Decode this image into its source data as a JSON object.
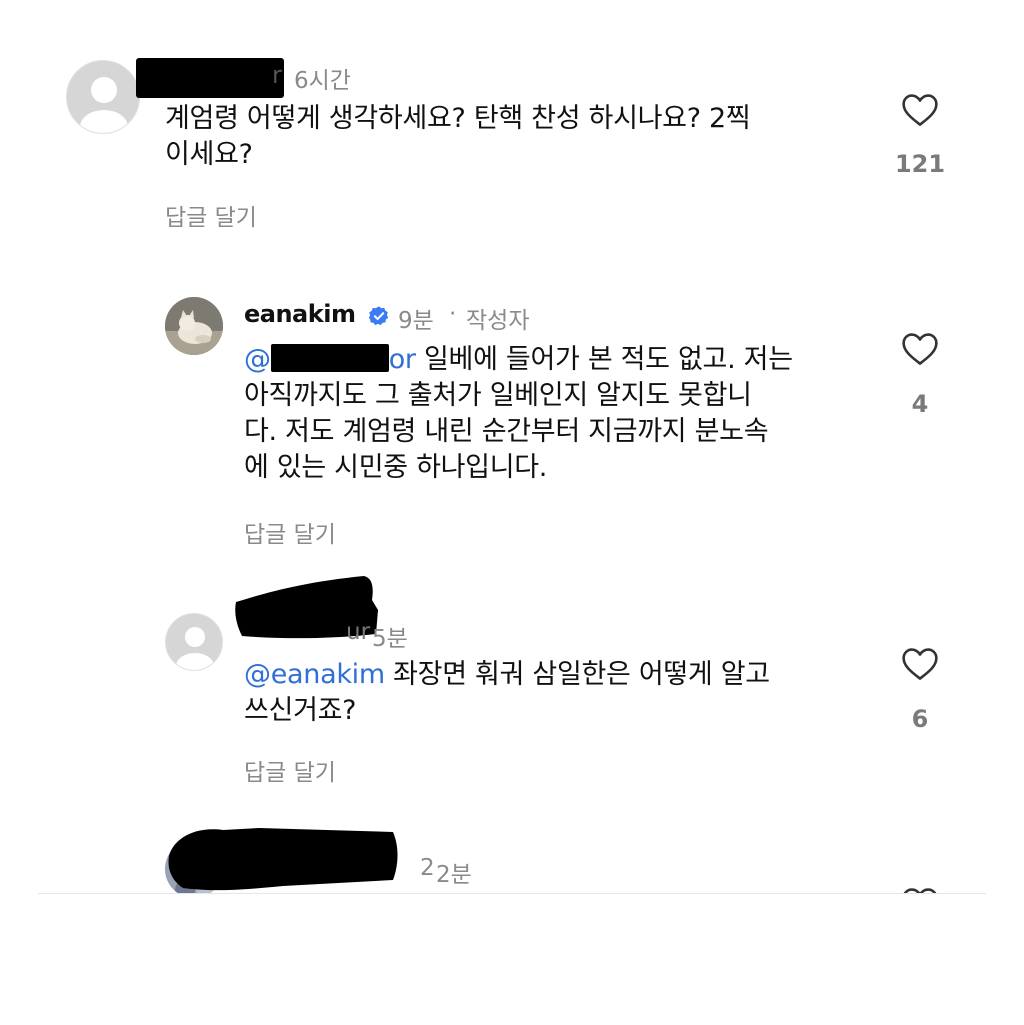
{
  "colors": {
    "mention": "#2f6fd6",
    "meta": "#8a8a8a",
    "verified": "#3b7bf6"
  },
  "comments": [
    {
      "username_visible": "r",
      "time": "6시간",
      "body_line1": "계엄령 어떻게 생각하세요? 탄핵 찬성 하시나요? 2찍",
      "body_line2": "이세요?",
      "likes": "121",
      "reply_label": "답글 달기",
      "like_icon": "heart-outline-icon"
    },
    {
      "username": "eanakim",
      "verified_icon": "verified-badge-icon",
      "time": "9분",
      "separator": "·",
      "author_tag": "작성자",
      "mention_start": "@",
      "mention_end": "or",
      "body_line1_rest": " 일베에 들어가 본 적도 없고. 저는",
      "body_line2": "아직까지도 그 출처가 일베인지 알지도 못합니",
      "body_line3": "다. 저도 계엄령 내린 순간부터 지금까지 분노속",
      "body_line4": "에 있는 시민중 하나입니다.",
      "likes": "4",
      "reply_label": "답글 달기",
      "like_icon": "heart-outline-icon"
    },
    {
      "username_visible": "ur",
      "time": "5분",
      "mention": "@eanakim",
      "body_line1_rest": " 좌장면 훠궈 삼일한은 어떻게 알고",
      "body_line2": "쓰신거죠?",
      "likes": "6",
      "reply_label": "답글 달기",
      "like_icon": "heart-outline-icon"
    },
    {
      "time_partial": "2",
      "time": "2분"
    }
  ]
}
